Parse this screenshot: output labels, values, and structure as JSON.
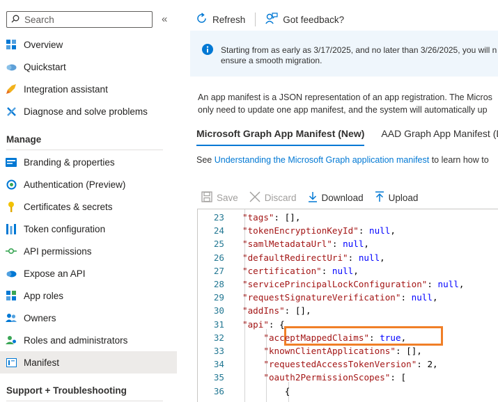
{
  "sidebar": {
    "search_placeholder": "Search",
    "collapse": "«",
    "items": [
      {
        "label": "Overview",
        "icon": "overview-grid-icon"
      },
      {
        "label": "Quickstart",
        "icon": "cloud-icon"
      },
      {
        "label": "Integration assistant",
        "icon": "rocket-icon"
      },
      {
        "label": "Diagnose and solve problems",
        "icon": "wrench-icon"
      }
    ],
    "manage_title": "Manage",
    "manage_items": [
      {
        "label": "Branding & properties",
        "icon": "branding-icon"
      },
      {
        "label": "Authentication (Preview)",
        "icon": "authentication-icon"
      },
      {
        "label": "Certificates & secrets",
        "icon": "key-icon"
      },
      {
        "label": "Token configuration",
        "icon": "token-bars-icon"
      },
      {
        "label": "API permissions",
        "icon": "api-permissions-icon"
      },
      {
        "label": "Expose an API",
        "icon": "cloud-api-icon"
      },
      {
        "label": "App roles",
        "icon": "app-roles-icon"
      },
      {
        "label": "Owners",
        "icon": "owners-icon"
      },
      {
        "label": "Roles and administrators",
        "icon": "roles-admin-icon"
      },
      {
        "label": "Manifest",
        "icon": "manifest-icon",
        "active": true
      }
    ],
    "support_title": "Support + Troubleshooting"
  },
  "commandbar": {
    "refresh": "Refresh",
    "feedback": "Got feedback?"
  },
  "banner": {
    "line1": "Starting from as early as 3/17/2025, and no later than 3/26/2025, you will n",
    "line2": "ensure a smooth migration."
  },
  "description": {
    "line1": "An app manifest is a JSON representation of an app registration. The Micros",
    "line2": "only need to update one app manifest, and the system will automatically up"
  },
  "tabs": [
    {
      "label": "Microsoft Graph App Manifest (New)",
      "active": true
    },
    {
      "label": "AAD Graph App Manifest (D",
      "active": false
    }
  ],
  "see_line": {
    "prefix": "See ",
    "link": "Understanding the Microsoft Graph application manifest",
    "suffix": " to learn how to"
  },
  "toolbar": {
    "save": "Save",
    "discard": "Discard",
    "download": "Download",
    "upload": "Upload"
  },
  "editor": {
    "lines": [
      {
        "n": "23",
        "indent": 2,
        "key": "\"tags\"",
        "rest": ": [],"
      },
      {
        "n": "24",
        "indent": 2,
        "key": "\"tokenEncryptionKeyId\"",
        "rest": ": ",
        "val": "null",
        "end": ","
      },
      {
        "n": "25",
        "indent": 2,
        "key": "\"samlMetadataUrl\"",
        "rest": ": ",
        "val": "null",
        "end": ","
      },
      {
        "n": "26",
        "indent": 2,
        "key": "\"defaultRedirectUri\"",
        "rest": ": ",
        "val": "null",
        "end": ","
      },
      {
        "n": "27",
        "indent": 2,
        "key": "\"certification\"",
        "rest": ": ",
        "val": "null",
        "end": ","
      },
      {
        "n": "28",
        "indent": 2,
        "key": "\"servicePrincipalLockConfiguration\"",
        "rest": ": ",
        "val": "null",
        "end": ","
      },
      {
        "n": "29",
        "indent": 2,
        "key": "\"requestSignatureVerification\"",
        "rest": ": ",
        "val": "null",
        "end": ","
      },
      {
        "n": "30",
        "indent": 2,
        "key": "\"addIns\"",
        "rest": ": [],"
      },
      {
        "n": "31",
        "indent": 2,
        "key": "\"api\"",
        "rest": ": {"
      },
      {
        "n": "32",
        "indent": 4,
        "key": "\"acceptMappedClaims\"",
        "rest": ": ",
        "val": "true",
        "end": ","
      },
      {
        "n": "33",
        "indent": 4,
        "key": "\"knownClientApplications\"",
        "rest": ": [],"
      },
      {
        "n": "34",
        "indent": 4,
        "key": "\"requestedAccessTokenVersion\"",
        "rest": ": ",
        "num": "2",
        "end": ","
      },
      {
        "n": "35",
        "indent": 4,
        "key": "\"oauth2PermissionScopes\"",
        "rest": ": ["
      },
      {
        "n": "36",
        "indent": 6,
        "key": "",
        "rest": "{"
      }
    ]
  }
}
